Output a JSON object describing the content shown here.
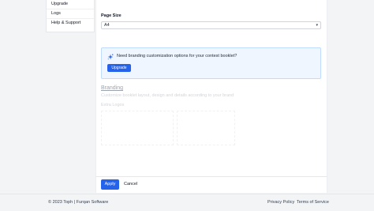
{
  "sidebar": {
    "items": [
      {
        "label": "Upgrade"
      },
      {
        "label": "Logs"
      },
      {
        "label": "Help & Support"
      }
    ]
  },
  "form": {
    "page_size_label": "Page Size",
    "page_size_value": "A4"
  },
  "callout": {
    "text": "Need branding customization options for your contest booklet?",
    "button_label": "Upgrade",
    "icon": "sparkles-icon"
  },
  "branding": {
    "title": "Branding",
    "description": "Customize booklet layout, design and details according to your brand",
    "extra_logos_label": "Extra Logos"
  },
  "actions": {
    "apply_label": "Apply",
    "cancel_label": "Cancel"
  },
  "footer": {
    "copyright": "© 2023 Toph | Furqan Software",
    "privacy": "Privacy Policy",
    "terms": "Terms of Service"
  },
  "colors": {
    "primary": "#2563eb",
    "callout_bg": "#eff6ff",
    "callout_border": "#bfdbfe"
  }
}
